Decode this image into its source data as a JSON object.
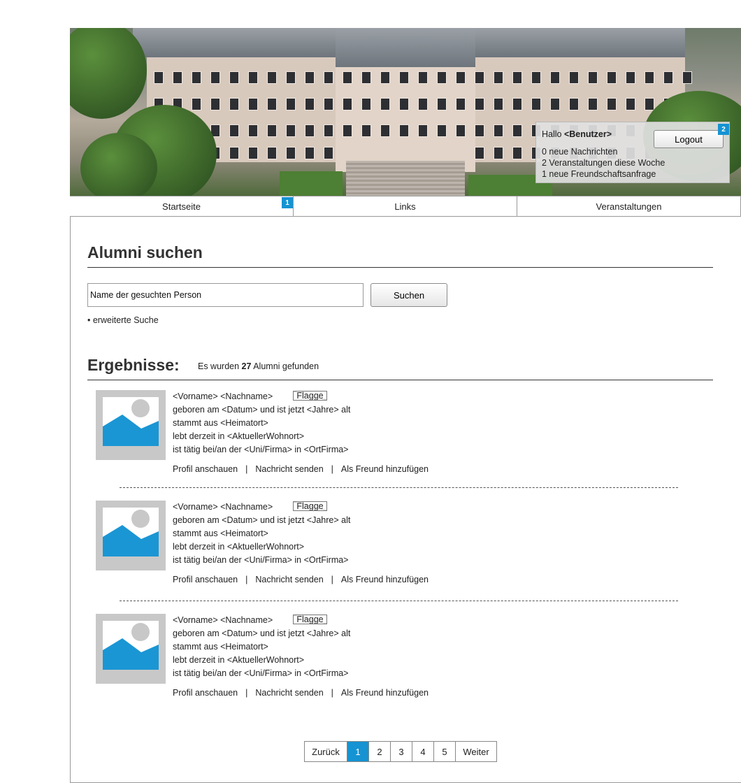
{
  "header": {
    "user": {
      "greeting_prefix": "Hallo ",
      "user_name": "<Benutzer>",
      "messages": "0 neue Nachrichten",
      "events": "2 Veranstaltungen diese Woche",
      "friend_requests": "1 neue Freundschaftsanfrage"
    },
    "logout_label": "Logout",
    "logout_badge": "2"
  },
  "nav": {
    "tabs": [
      {
        "label": "Startseite",
        "badge": "1"
      },
      {
        "label": "Links"
      },
      {
        "label": "Veranstaltungen"
      }
    ]
  },
  "search": {
    "title": "Alumni suchen",
    "input_value": "Name der gesuchten Person",
    "button_label": "Suchen",
    "advanced_label": "• erweiterte Suche"
  },
  "results": {
    "heading": "Ergebnisse:",
    "count_prefix": "Es wurden ",
    "count": "27",
    "count_suffix": " Alumni gefunden",
    "items": [
      {
        "name": "<Vorname> <Nachname>",
        "flag": "Flagge",
        "born": "geboren am <Datum> und ist jetzt <Jahre> alt",
        "origin": "stammt aus <Heimatort>",
        "residence": "lebt derzeit in <AktuellerWohnort>",
        "work": "ist tätig bei/an der <Uni/Firma> in <OrtFirma>",
        "actions": [
          "Profil anschauen",
          "Nachricht senden",
          "Als Freund hinzufügen"
        ]
      },
      {
        "name": "<Vorname> <Nachname>",
        "flag": "Flagge",
        "born": "geboren am <Datum> und ist jetzt <Jahre> alt",
        "origin": "stammt aus <Heimatort>",
        "residence": "lebt derzeit in <AktuellerWohnort>",
        "work": "ist tätig bei/an der <Uni/Firma> in <OrtFirma>",
        "actions": [
          "Profil anschauen",
          "Nachricht senden",
          "Als Freund hinzufügen"
        ]
      },
      {
        "name": "<Vorname> <Nachname>",
        "flag": "Flagge",
        "born": "geboren am <Datum> und ist jetzt <Jahre> alt",
        "origin": "stammt aus <Heimatort>",
        "residence": "lebt derzeit in <AktuellerWohnort>",
        "work": "ist tätig bei/an der <Uni/Firma> in <OrtFirma>",
        "actions": [
          "Profil anschauen",
          "Nachricht senden",
          "Als Freund hinzufügen"
        ]
      }
    ],
    "separator": "|"
  },
  "pagination": {
    "prev": "Zurück",
    "pages": [
      "1",
      "2",
      "3",
      "4",
      "5"
    ],
    "active_page": "1",
    "next": "Weiter"
  },
  "colors": {
    "accent": "#1593d2",
    "placeholder_gray": "#c8c8c8"
  }
}
